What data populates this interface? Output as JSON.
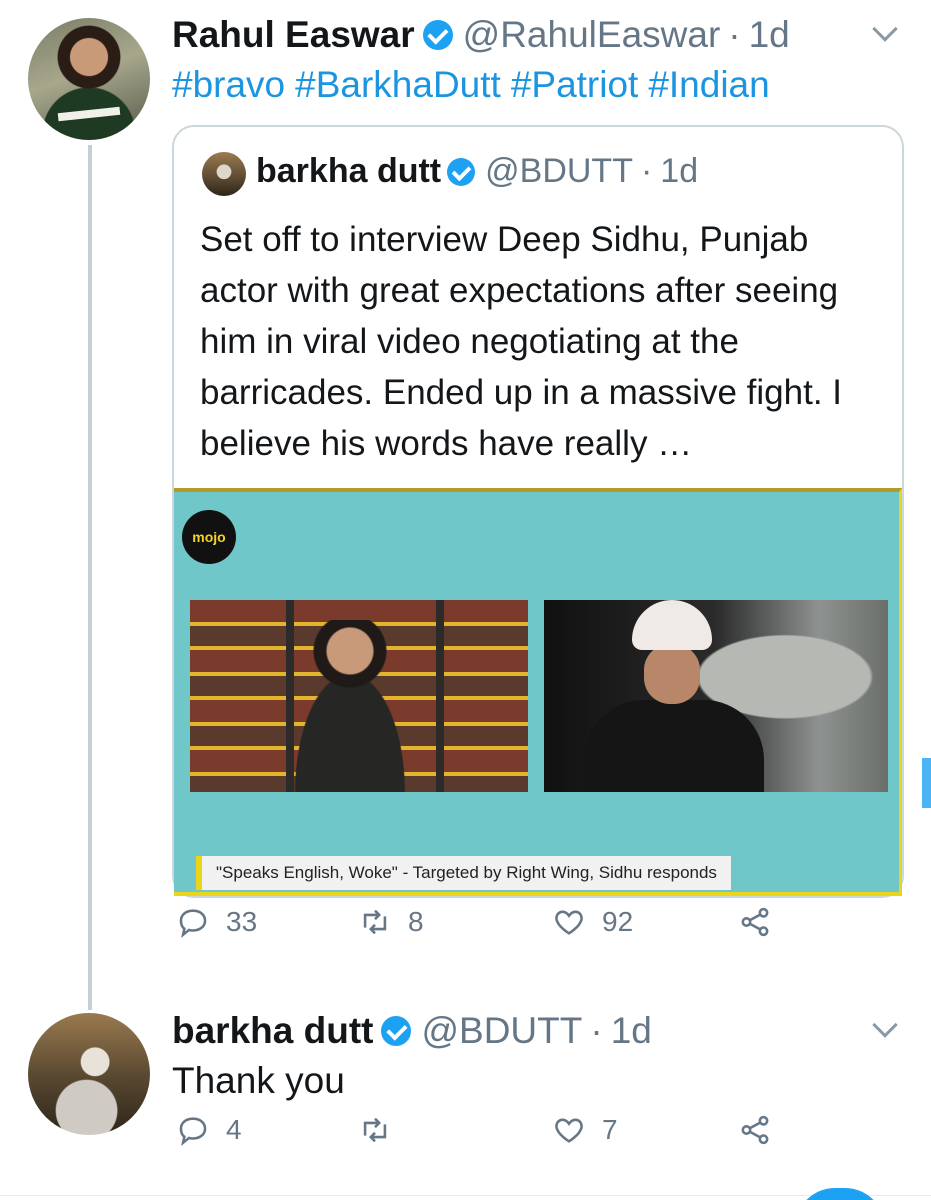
{
  "tweet": {
    "author_name": "Rahul Easwar",
    "handle": "@RahulEaswar",
    "separator": "·",
    "time": "1d",
    "hashtags": [
      "#bravo",
      "#BarkhaDutt",
      "#Patriot",
      "#Indian"
    ],
    "quoted": {
      "author_name": "barkha dutt",
      "handle": "@BDUTT",
      "separator": "·",
      "time": "1d",
      "text": "Set off to interview Deep Sidhu, Punjab actor with great expectations after seeing him in viral video negotiating at the barricades. Ended up in a massive fight. I believe his words have really …",
      "media": {
        "logo_text": "mojo",
        "caption": "\"Speaks English, Woke\" - Targeted by Right Wing, Sidhu responds"
      }
    },
    "actions": {
      "replies": "33",
      "retweets": "8",
      "likes": "92"
    }
  },
  "reply": {
    "author_name": "barkha dutt",
    "handle": "@BDUTT",
    "separator": "·",
    "time": "1d",
    "text": "Thank you",
    "actions": {
      "replies": "4",
      "retweets": "",
      "likes": "7"
    }
  },
  "icons": {
    "reply": "reply-icon",
    "retweet": "retweet-icon",
    "like": "heart-icon",
    "share": "share-icon",
    "verified": "verified-badge-icon",
    "menu": "chevron-down-icon"
  },
  "colors": {
    "link": "#1b95e0",
    "verified": "#1da1f2",
    "muted": "#657786",
    "text": "#14171a"
  }
}
